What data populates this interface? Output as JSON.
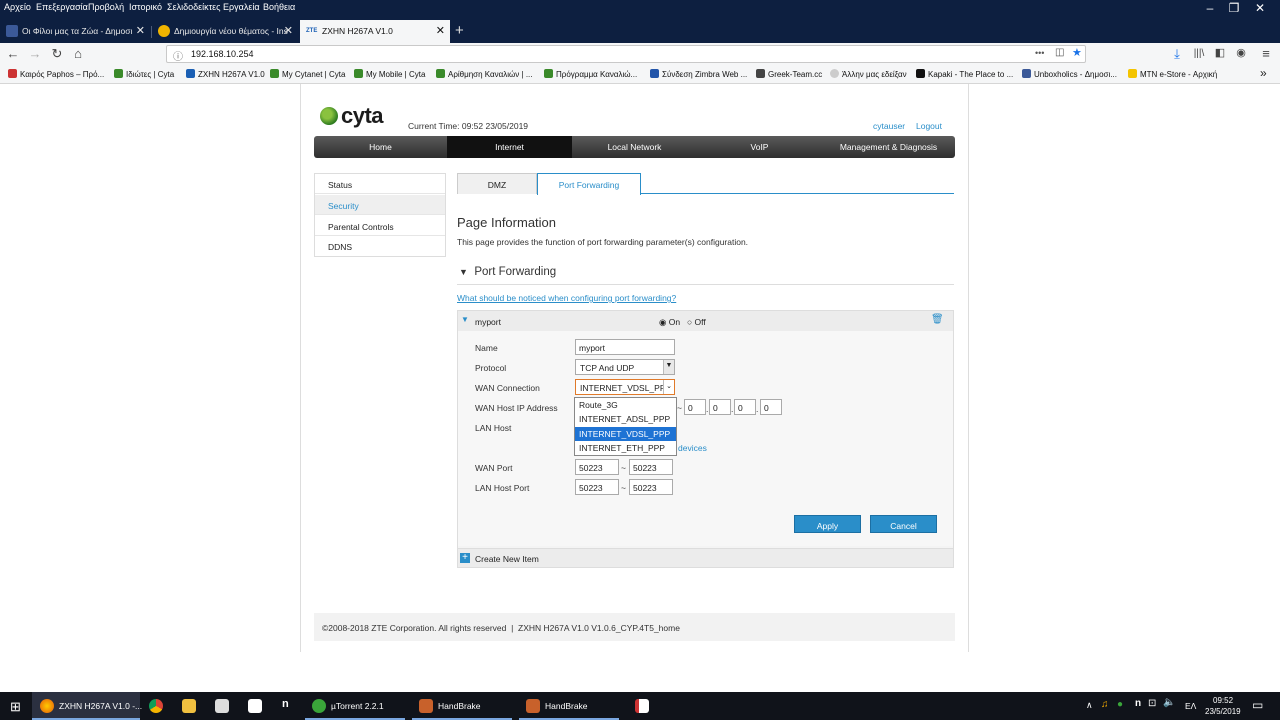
{
  "menubar": {
    "items": [
      "Αρχείο",
      "Επεξεργασία",
      "Προβολή",
      "Ιστορικό",
      "Σελιδοδείκτες",
      "Εργαλεία",
      "Βοήθεια"
    ]
  },
  "tabs": [
    {
      "label": "Οι Φίλοι μας τα Ζώα - Δημοσι",
      "icon": "facebook-icon"
    },
    {
      "label": "Δημιουργία νέου θέματος - Ins",
      "icon": "forum-icon"
    },
    {
      "label": "ZXHN H267A V1.0",
      "icon": "zte-icon"
    }
  ],
  "url": "192.168.10.254",
  "url_menu": "•••",
  "bookmarks": [
    "Καιρός Paphos – Πρό...",
    "Ιδιώτες | Cyta",
    "ZXHN H267A V1.0",
    "My Cytanet | Cyta",
    "My Mobile | Cyta",
    "Αρίθμηση Καναλιών | ...",
    "Πρόγραμμα Καναλιώ...",
    "Σύνδεση Zimbra Web ...",
    "Greek-Team.cc",
    "Άλλην μας εδείξαν",
    "Kapaki - The Place to ...",
    "Unboxholics - Δημοσι...",
    "MTN e-Store - Αρχική"
  ],
  "header": {
    "logo": "cyta",
    "current_time": "Current Time: 09:52 23/05/2019",
    "user": "cytauser",
    "logout": "Logout"
  },
  "mainnav": [
    "Home",
    "Internet",
    "Local Network",
    "VoIP",
    "Management & Diagnosis"
  ],
  "sidebar": [
    "Status",
    "Security",
    "Parental Controls",
    "DDNS"
  ],
  "subtabs": [
    "DMZ",
    "Port Forwarding"
  ],
  "page_info": {
    "title": "Page Information",
    "description": "This page provides the function of port forwarding parameter(s) configuration."
  },
  "port_forwarding": {
    "section_title": "Port Forwarding",
    "notice_link": "What should be noticed when configuring port forwarding?",
    "rule_name": "myport",
    "on_label": "On",
    "off_label": "Off",
    "fields": {
      "name_label": "Name",
      "name_value": "myport",
      "protocol_label": "Protocol",
      "protocol_value": "TCP And UDP",
      "wan_conn_label": "WAN Connection",
      "wan_conn_value": "INTERNET_VDSL_PPP",
      "wan_host_label": "WAN Host IP Address",
      "wan_host_ip": [
        "0",
        "0",
        "0",
        "0"
      ],
      "lan_host_label": "LAN Host",
      "devices_link": "devices",
      "wan_port_label": "WAN Port",
      "wan_port_from": "50223",
      "wan_port_to": "50223",
      "lan_port_label": "LAN Host Port",
      "lan_port_from": "50223",
      "lan_port_to": "50223",
      "tilde": "~"
    },
    "dropdown_options": [
      "Route_3G",
      "INTERNET_ADSL_PPP",
      "INTERNET_VDSL_PPP",
      "INTERNET_ETH_PPP"
    ],
    "apply": "Apply",
    "cancel": "Cancel",
    "create_new": "Create New Item"
  },
  "footer": "©2008-2018 ZTE Corporation. All rights reserved  |  ZXHN H267A V1.0 V1.0.6_CYP.4T5_home",
  "taskbar": {
    "items": [
      "ZXHN H267A V1.0 -...",
      "µTorrent 2.2.1",
      "HandBrake",
      "HandBrake"
    ],
    "lang": "ΕΛ",
    "time": "09:52",
    "date": "23/5/2019"
  },
  "colors": {
    "accent": "#2a8ec9",
    "titlebar": "#0d1f40",
    "highlight": "#1e73d4"
  }
}
